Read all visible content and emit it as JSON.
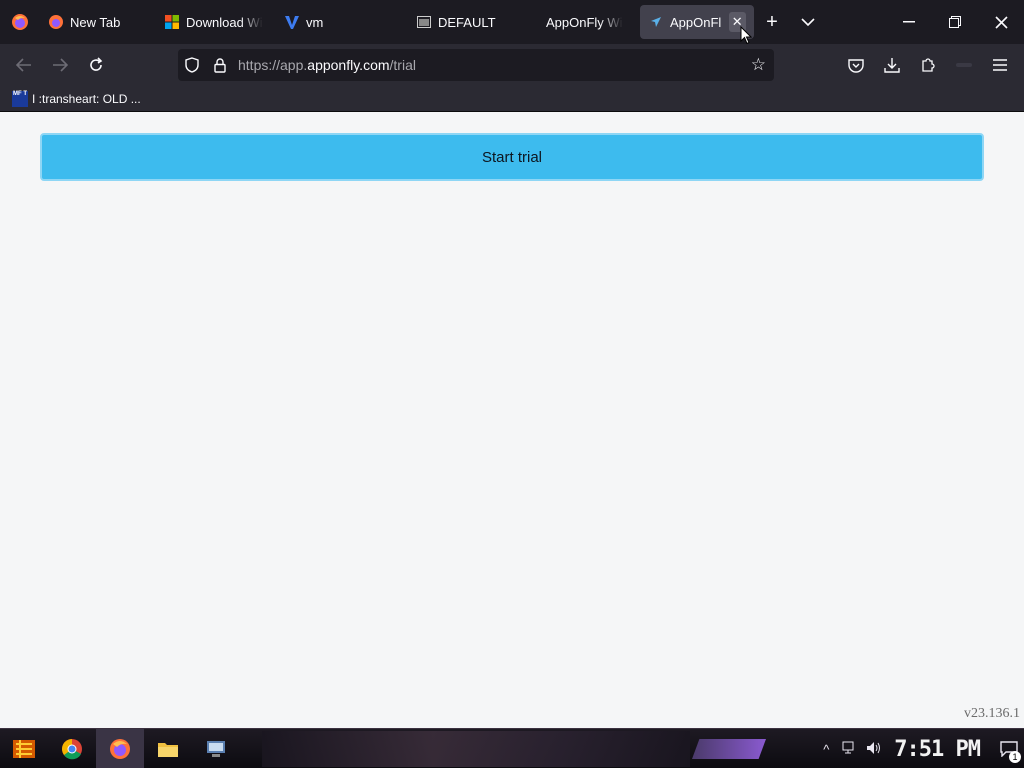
{
  "browser": {
    "tabs": [
      {
        "label": "New Tab",
        "icon": "firefox-icon"
      },
      {
        "label": "Download Wi",
        "icon": "windows-logo-icon"
      },
      {
        "label": "vm",
        "icon": "v-logo-icon"
      },
      {
        "label": "DEFAULT",
        "icon": "window-icon"
      },
      {
        "label": "AppOnFly Wi",
        "icon": "none"
      },
      {
        "label": "AppOnFly",
        "icon": "paper-plane-icon",
        "active": true
      }
    ],
    "url_prefix": "https://app.",
    "url_host": "apponfly.com",
    "url_path": "/trial",
    "bookmarks": [
      {
        "label": "I :transheart: OLD ...",
        "icon_text": "MF T"
      }
    ]
  },
  "page": {
    "start_button_label": "Start trial",
    "version": "v23.136.1"
  },
  "taskbar": {
    "clock": "7:51 PM",
    "notification_count": "1"
  },
  "colors": {
    "accent_button": "#3dbbee",
    "chrome_dark": "#1c1b22",
    "chrome_mid": "#2b2a33"
  }
}
